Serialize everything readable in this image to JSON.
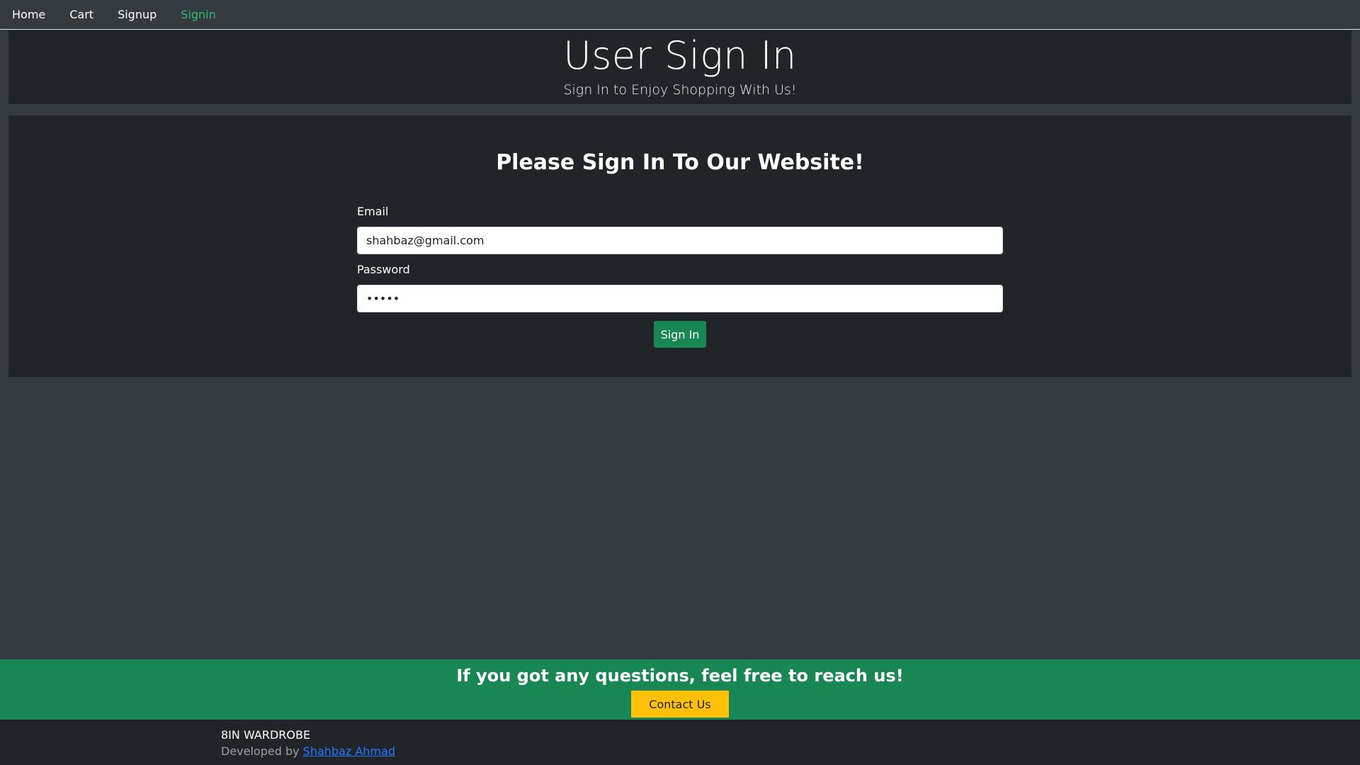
{
  "nav": {
    "items": [
      {
        "label": "Home"
      },
      {
        "label": "Cart"
      },
      {
        "label": "Signup"
      },
      {
        "label": "Signin"
      }
    ],
    "active_index": 3,
    "active_color": "#2fbf71"
  },
  "header": {
    "title": "User Sign In",
    "subtitle": "Sign In to Enjoy Shopping With Us!"
  },
  "form": {
    "heading": "Please Sign In To Our Website!",
    "email_label": "Email",
    "email_value": "shahbaz@gmail.com",
    "password_label": "Password",
    "password_value": "•••••",
    "submit_label": "Sign In"
  },
  "contact": {
    "text": "If you got any questions, feel free to reach us!",
    "button_label": "Contact Us"
  },
  "footer": {
    "brand": "8IN WARDROBE",
    "developed_by": "Developed by ",
    "developer_name": "Shahbaz Ahmad"
  },
  "colors": {
    "background": "#343a40",
    "panel": "#212529",
    "primary_green": "#198754",
    "warning_yellow": "#ffc107",
    "link_blue": "#1f7bff"
  }
}
